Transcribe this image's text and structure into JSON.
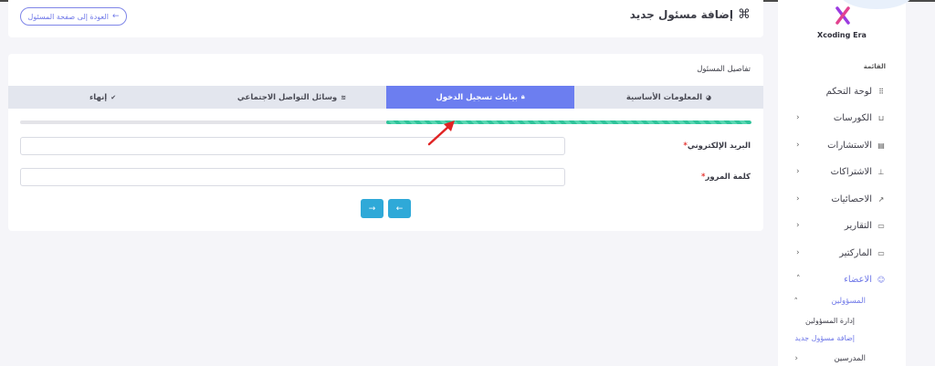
{
  "header": {
    "title": "إضافة مسئول جديد",
    "title_icon": "⌘",
    "back_button_label": "العودة إلى صفحة المسئول",
    "back_icon": "arrow-left-icon"
  },
  "sidebar": {
    "brand_name": "Xcoding Era",
    "menu_heading": "القائمة",
    "items": [
      {
        "label": "لوحة التحكم",
        "icon": "grid-icon",
        "glyph": "⠿",
        "expandable": false
      },
      {
        "label": "الكورسات",
        "icon": "basket-icon",
        "glyph": "⊔",
        "expandable": true
      },
      {
        "label": "الاستشارات",
        "icon": "document-icon",
        "glyph": "▤",
        "expandable": true
      },
      {
        "label": "الاشتراكات",
        "icon": "sitemap-icon",
        "glyph": "⊥",
        "expandable": true
      },
      {
        "label": "الاحصائيات",
        "icon": "trend-icon",
        "glyph": "↗",
        "expandable": true
      },
      {
        "label": "التقارير",
        "icon": "inbox-icon",
        "glyph": "▭",
        "expandable": true
      },
      {
        "label": "الماركتير",
        "icon": "archive-icon",
        "glyph": "▭",
        "expandable": true
      },
      {
        "label": "الاعضاء",
        "icon": "users-icon",
        "glyph": "☺",
        "expandable": true,
        "active": true
      }
    ],
    "sub_items": [
      {
        "label": "المسؤولين",
        "active": true
      },
      {
        "label": "المدرسين",
        "active": false
      }
    ],
    "sub_children": [
      {
        "label": "إدارة المسؤولين",
        "active": false
      },
      {
        "label": "إضافة مسؤول جديد",
        "active": true
      }
    ]
  },
  "form": {
    "card_title": "تفاصيل المسئول",
    "tabs": [
      {
        "label": "المعلومات الأساسية",
        "icon": "pie-icon",
        "glyph": "◕"
      },
      {
        "label": "بيانات تسجيل الدخول",
        "icon": "lock-icon",
        "glyph": "🔒",
        "active": true
      },
      {
        "label": "وسائل التواصل الاجتماعي",
        "icon": "wifi-icon",
        "glyph": "≋"
      },
      {
        "label": "إنهاء",
        "icon": "check-circle-icon",
        "glyph": "✓"
      }
    ],
    "progress": 0.5,
    "fields": [
      {
        "label": "البريد الإلكتروني",
        "required_mark": "*",
        "value": ""
      },
      {
        "label": "كلمة المرور",
        "required_mark": "*",
        "value": ""
      }
    ],
    "nav_buttons": {
      "next_glyph": "→",
      "prev_glyph": "←"
    }
  },
  "colors": {
    "accent": "#6c7ef0",
    "progress": "#2fc39a",
    "nav_button": "#2fa9d8",
    "annotation_arrow": "#e02424"
  }
}
